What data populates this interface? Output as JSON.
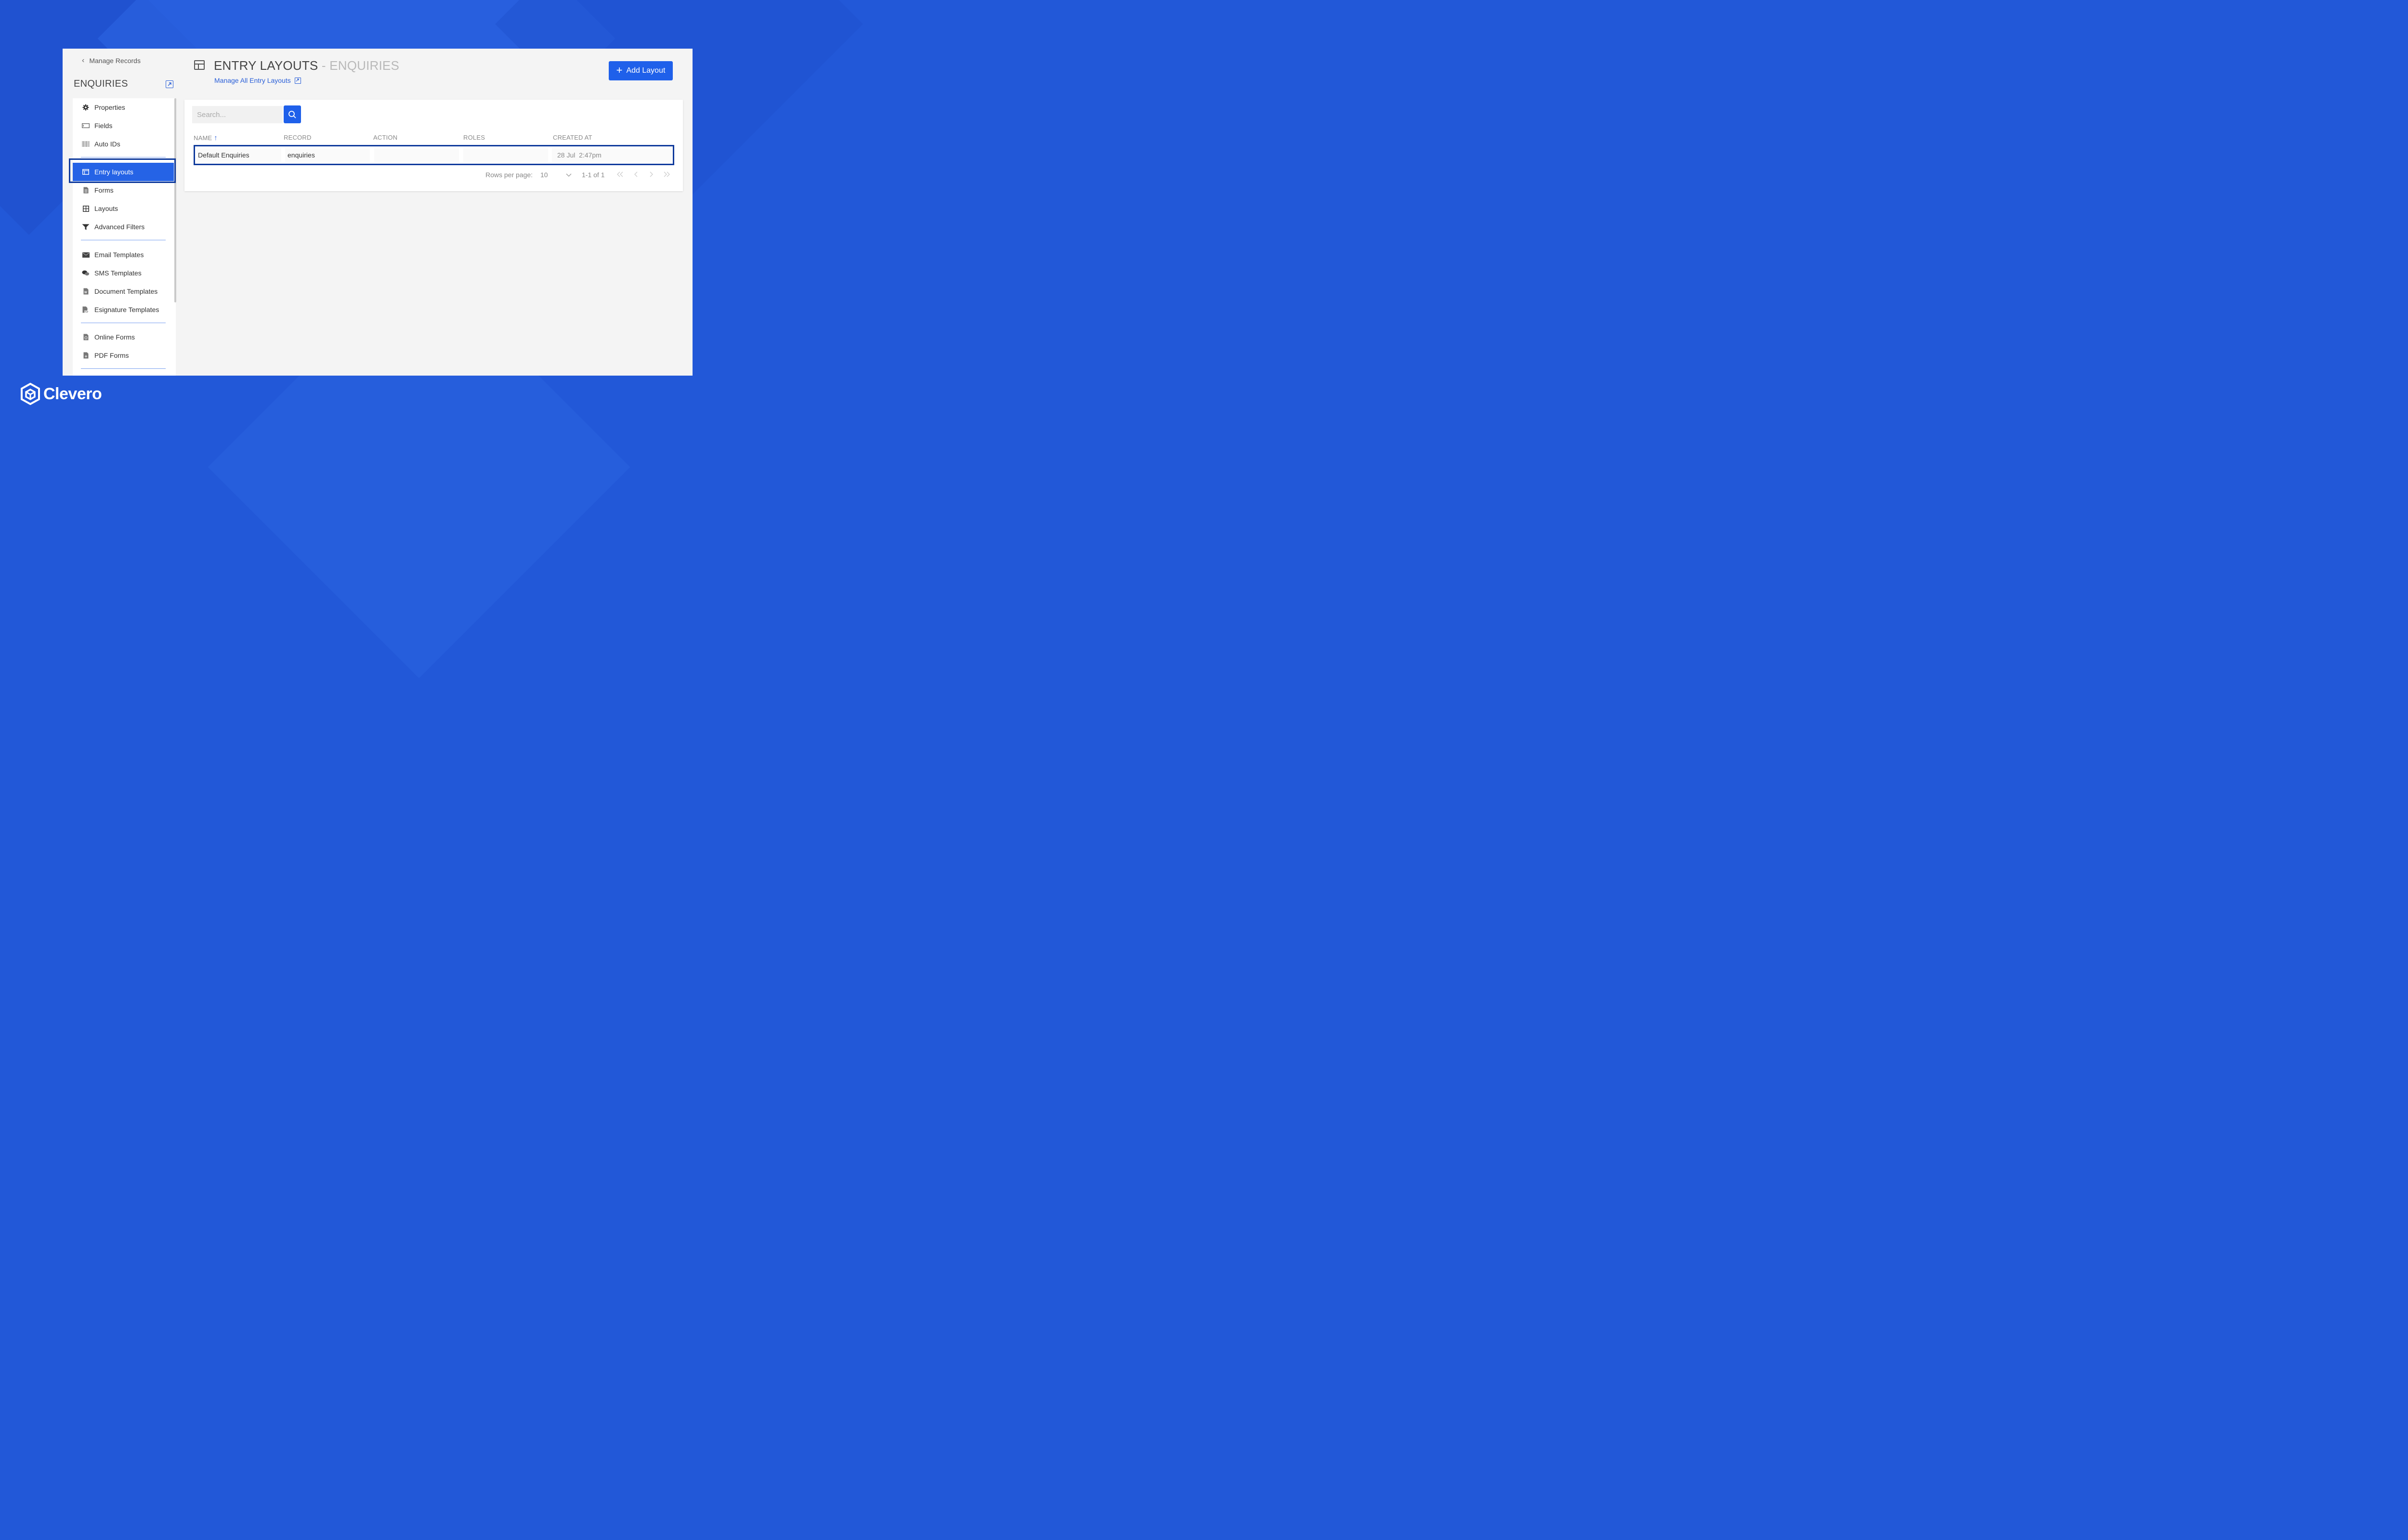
{
  "sidebar": {
    "back_label": "Manage Records",
    "title": "ENQUIRIES",
    "items": [
      {
        "label": "Properties",
        "icon": "gear-icon"
      },
      {
        "label": "Fields",
        "icon": "field-icon"
      },
      {
        "label": "Auto IDs",
        "icon": "barcode-icon"
      },
      {
        "label": "Entry layouts",
        "icon": "layout-icon",
        "active": true
      },
      {
        "label": "Forms",
        "icon": "document-icon"
      },
      {
        "label": "Layouts",
        "icon": "grid-icon"
      },
      {
        "label": "Advanced Filters",
        "icon": "filter-icon"
      },
      {
        "label": "Email Templates",
        "icon": "envelope-icon"
      },
      {
        "label": "SMS Templates",
        "icon": "chat-icon"
      },
      {
        "label": "Document Templates",
        "icon": "word-doc-icon"
      },
      {
        "label": "Esignature Templates",
        "icon": "pdf-doc-icon"
      },
      {
        "label": "Online Forms",
        "icon": "online-form-icon"
      },
      {
        "label": "PDF Forms",
        "icon": "pdf-form-icon"
      }
    ]
  },
  "header": {
    "title": "ENTRY LAYOUTS",
    "subtitle": "- ENQUIRIES",
    "manage_link": "Manage All Entry Layouts",
    "add_button": "Add Layout"
  },
  "table": {
    "search_placeholder": "Search...",
    "columns": [
      "NAME",
      "RECORD",
      "ACTION",
      "ROLES",
      "CREATED AT"
    ],
    "sort": {
      "column": "NAME",
      "direction": "asc"
    },
    "rows": [
      {
        "name": "Default Enquiries",
        "record": "enquiries",
        "action": "",
        "roles": "",
        "created_at": "28 Jul  2:47pm"
      }
    ],
    "pagination": {
      "rows_per_page_label": "Rows per page:",
      "rows_per_page": "10",
      "range": "1-1 of 1"
    }
  },
  "brand": {
    "name": "Clevero"
  },
  "colors": {
    "accent": "#1f60ea",
    "highlight_border": "#0f3a9c",
    "background": "#2258d8"
  }
}
